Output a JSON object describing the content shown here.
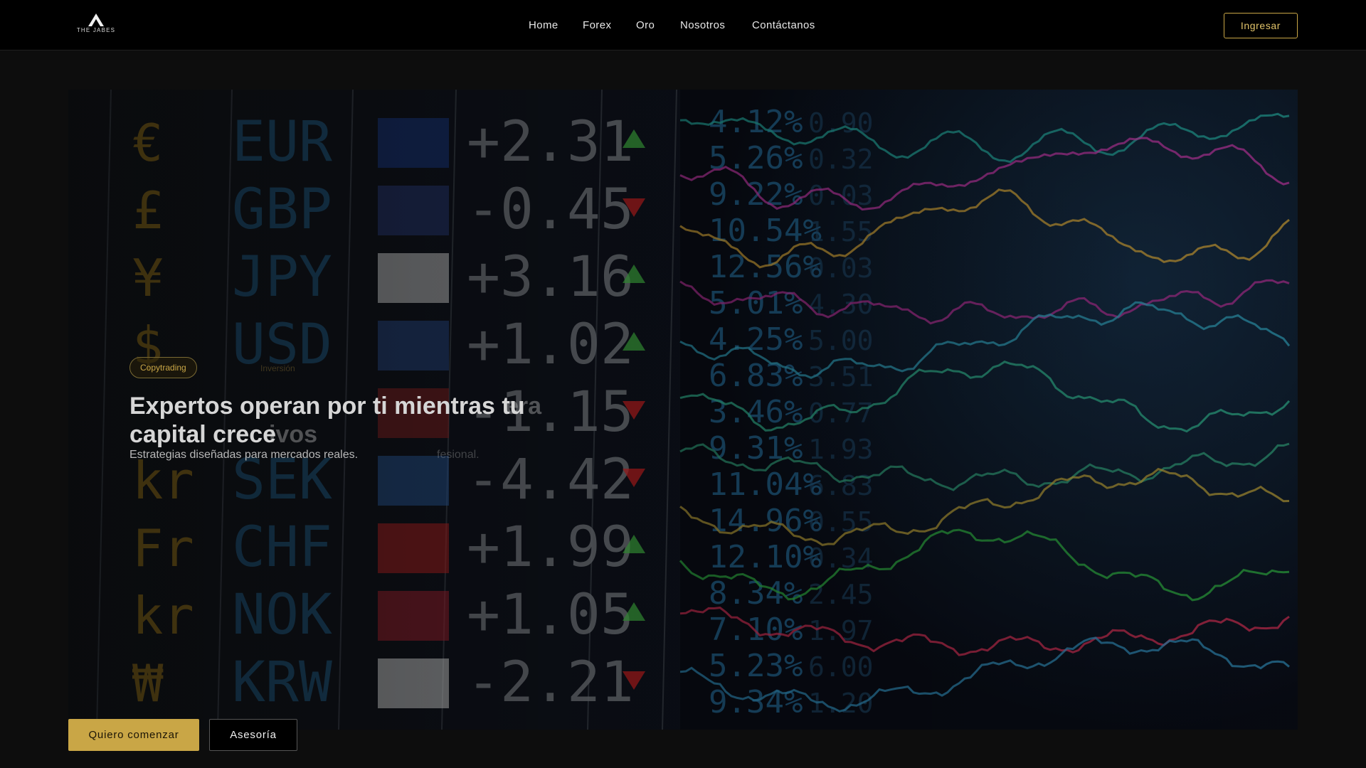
{
  "header": {
    "logo_text": "THE JABES",
    "nav": [
      "Home",
      "Forex",
      "Oro",
      "Nosotros",
      "Contáctanos"
    ],
    "login_label": "Ingresar"
  },
  "hero": {
    "badge": "Copytrading",
    "badge_ghost": "Inversión",
    "headline": "Expertos operan por ti mientras tu capital crece",
    "headline_ghost_1": "era",
    "headline_ghost_2": "ivos",
    "subline": "Estrategias diseñadas para mercados reales.",
    "subline_ghost": "fesional.",
    "board": {
      "symbols": [
        "€",
        "£",
        "¥",
        "$",
        "",
        "kr",
        "Fr",
        "kr",
        "₩"
      ],
      "currencies": [
        "EUR",
        "GBP",
        "JPY",
        "USD",
        "",
        "SEK",
        "CHF",
        "NOK",
        "KRW"
      ],
      "changes": [
        "+2.31",
        "-0.45",
        "+3.16",
        "+1.02",
        "-1.15",
        "-4.42",
        "+1.99",
        "+1.05",
        "-2.21"
      ],
      "percents": [
        "4.12%",
        "5.26%",
        "9.22%",
        "10.54%",
        "12.56%",
        "5.01%",
        "4.25%",
        "6.83%",
        "3.46%",
        "9.31%",
        "11.04%",
        "14.96%",
        "12.10%",
        "8.34%",
        "7.10%",
        "5.23%",
        "9.34%"
      ],
      "secondary": [
        "0.90",
        "0.32",
        "0.03",
        "1.55",
        "0.03",
        "4.30",
        "5.00",
        "3.51",
        "0.77",
        "1.93",
        "6.83",
        "0.55",
        "0.34",
        "2.45",
        "1.97",
        "6.00",
        "1.20"
      ],
      "colors": {
        "up": "#3fae3f",
        "down": "#c82020"
      }
    }
  },
  "cta": {
    "primary": "Quiero comenzar",
    "secondary": "Asesoría"
  },
  "colors": {
    "accent": "#c9a646",
    "background": "#0d0d0d",
    "header": "#000000"
  }
}
